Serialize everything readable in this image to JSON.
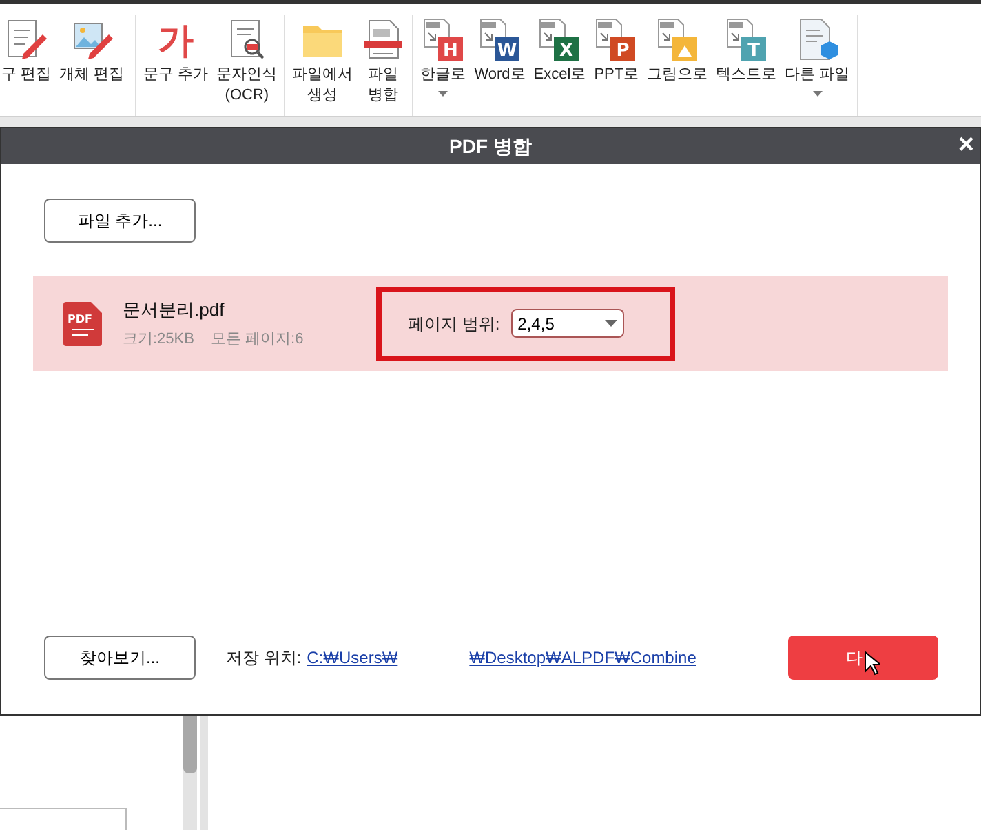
{
  "ribbon": {
    "groups": [
      {
        "items": [
          {
            "label": "구 편집",
            "dropdown": false
          },
          {
            "label": "개체 편집",
            "dropdown": false
          }
        ]
      },
      {
        "items": [
          {
            "label": "문구 추가",
            "glyph": "가",
            "dropdown": false
          },
          {
            "label": "문자인식\n(OCR)",
            "dropdown": false
          }
        ]
      },
      {
        "items": [
          {
            "label": "파일에서\n생성",
            "dropdown": false
          },
          {
            "label": "파일\n병합",
            "dropdown": false
          }
        ]
      },
      {
        "items": [
          {
            "label": "한글로",
            "badge": "H",
            "color": "#e04848",
            "dropdown": true
          },
          {
            "label": "Word로",
            "badge": "W",
            "color": "#2b5797",
            "dropdown": false
          },
          {
            "label": "Excel로",
            "badge": "X",
            "color": "#1e7145",
            "dropdown": false
          },
          {
            "label": "PPT로",
            "badge": "P",
            "color": "#d04a23",
            "dropdown": false
          },
          {
            "label": "그림으로",
            "color": "#f4b63a",
            "dropdown": false
          },
          {
            "label": "텍스트로",
            "badge": "T",
            "color": "#4fa3b0",
            "dropdown": false
          },
          {
            "label": "다른 파일",
            "dropdown": true
          }
        ]
      }
    ]
  },
  "dialog": {
    "title": "PDF 병합",
    "close": "×",
    "add_button": "파일 추가...",
    "files": [
      {
        "icon_text": "PDF",
        "name": "문서분리.pdf",
        "size": "크기:25KB",
        "pages": "모든 페이지:6",
        "range_label": "페이지 범위:",
        "range_value": "2,4,5",
        "selected": true,
        "highlighted": true
      }
    ],
    "browse_button": "찾아보기...",
    "save_label": "저장 위치:",
    "save_path": [
      "C:₩Users₩",
      "₩Desktop₩ALPDF₩Combine"
    ],
    "next_button": "다"
  }
}
